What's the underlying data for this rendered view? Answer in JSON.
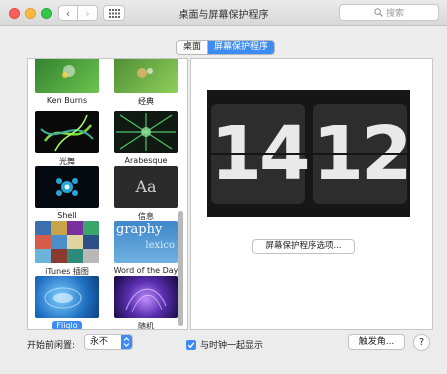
{
  "window": {
    "title": "桌面与屏幕保护程序",
    "search_placeholder": "搜索"
  },
  "tabs": [
    {
      "label": "桌面",
      "active": false
    },
    {
      "label": "屏幕保护程序",
      "active": true
    }
  ],
  "screensavers": [
    {
      "name": "Ken Burns",
      "selected": false
    },
    {
      "name": "经典",
      "selected": false
    },
    {
      "name": "光舞",
      "selected": false
    },
    {
      "name": "Arabesque",
      "selected": false
    },
    {
      "name": "Shell",
      "selected": false
    },
    {
      "name": "信息",
      "selected": false
    },
    {
      "name": "iTunes 插图",
      "selected": false
    },
    {
      "name": "Word of the Day",
      "selected": false
    },
    {
      "name": "Fliqlo",
      "selected": true
    },
    {
      "name": "随机",
      "selected": false
    }
  ],
  "thumb_text": {
    "info": "Aa",
    "word_line1": "graphy",
    "word_line2": "lexico"
  },
  "preview": {
    "hours": "14",
    "minutes": "12",
    "options_button": "屏幕保护程序选项..."
  },
  "bottom": {
    "idle_label": "开始前闲置:",
    "idle_value": "永不",
    "show_clock_label": "与时钟一起显示",
    "show_clock_checked": true,
    "hot_corners_button": "触发角...",
    "help_label": "?"
  },
  "colors": {
    "accent": "#3c8cf3",
    "background": "#ececec"
  }
}
